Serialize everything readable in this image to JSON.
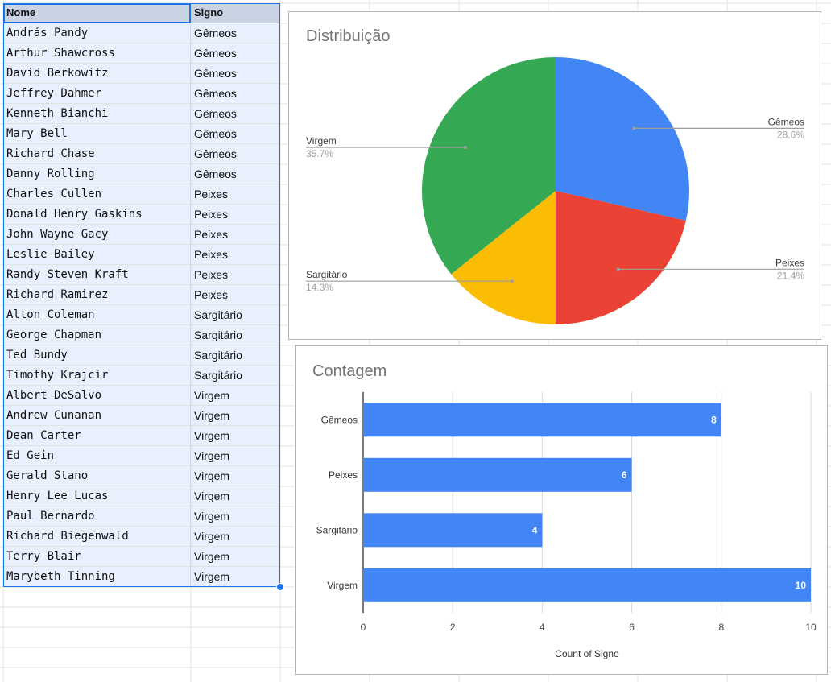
{
  "sheet": {
    "headers": {
      "name": "Nome",
      "sign": "Signo"
    },
    "rows": [
      {
        "name": "András Pandy",
        "sign": "Gêmeos"
      },
      {
        "name": "Arthur Shawcross",
        "sign": "Gêmeos"
      },
      {
        "name": "David Berkowitz",
        "sign": "Gêmeos"
      },
      {
        "name": "Jeffrey Dahmer",
        "sign": "Gêmeos"
      },
      {
        "name": "Kenneth Bianchi",
        "sign": "Gêmeos"
      },
      {
        "name": "Mary Bell",
        "sign": "Gêmeos"
      },
      {
        "name": "Richard Chase",
        "sign": "Gêmeos"
      },
      {
        "name": "Danny Rolling",
        "sign": "Gêmeos"
      },
      {
        "name": "Charles Cullen",
        "sign": "Peixes"
      },
      {
        "name": "Donald Henry Gaskins",
        "sign": "Peixes"
      },
      {
        "name": "John Wayne Gacy",
        "sign": "Peixes"
      },
      {
        "name": "Leslie Bailey",
        "sign": "Peixes"
      },
      {
        "name": "Randy Steven Kraft",
        "sign": "Peixes"
      },
      {
        "name": "Richard Ramirez",
        "sign": "Peixes"
      },
      {
        "name": "Alton Coleman",
        "sign": "Sargitário"
      },
      {
        "name": "George Chapman",
        "sign": "Sargitário"
      },
      {
        "name": "Ted Bundy",
        "sign": "Sargitário"
      },
      {
        "name": "Timothy Krajcir",
        "sign": "Sargitário"
      },
      {
        "name": "Albert DeSalvo",
        "sign": "Virgem"
      },
      {
        "name": "Andrew Cunanan",
        "sign": "Virgem"
      },
      {
        "name": "Dean Carter",
        "sign": "Virgem"
      },
      {
        "name": "Ed Gein",
        "sign": "Virgem"
      },
      {
        "name": "Gerald Stano",
        "sign": "Virgem"
      },
      {
        "name": "Henry Lee Lucas",
        "sign": "Virgem"
      },
      {
        "name": "Paul Bernardo",
        "sign": "Virgem"
      },
      {
        "name": "Richard Biegenwald",
        "sign": "Virgem"
      },
      {
        "name": "Terry Blair",
        "sign": "Virgem"
      },
      {
        "name": "Marybeth Tinning",
        "sign": "Virgem"
      }
    ]
  },
  "chart_data": [
    {
      "type": "pie",
      "title": "Distribuição",
      "categories": [
        "Gêmeos",
        "Peixes",
        "Sargitário",
        "Virgem"
      ],
      "values": [
        8,
        6,
        4,
        10
      ],
      "percent_labels": [
        "28.6%",
        "21.4%",
        "14.3%",
        "35.7%"
      ],
      "colors": [
        "#4285f4",
        "#ea4335",
        "#fbbc04",
        "#34a853"
      ],
      "legend": "callout-labels"
    },
    {
      "type": "bar",
      "orientation": "horizontal",
      "title": "Contagem",
      "categories": [
        "Gêmeos",
        "Peixes",
        "Sargitário",
        "Virgem"
      ],
      "values": [
        8,
        6,
        4,
        10
      ],
      "value_labels": [
        "8",
        "6",
        "4",
        "10"
      ],
      "xlabel": "Count of Signo",
      "ylabel": "",
      "xlim": [
        0,
        10
      ],
      "xticks": [
        "0",
        "2",
        "4",
        "6",
        "8",
        "10"
      ],
      "grid": true,
      "color": "#4285f4"
    }
  ]
}
